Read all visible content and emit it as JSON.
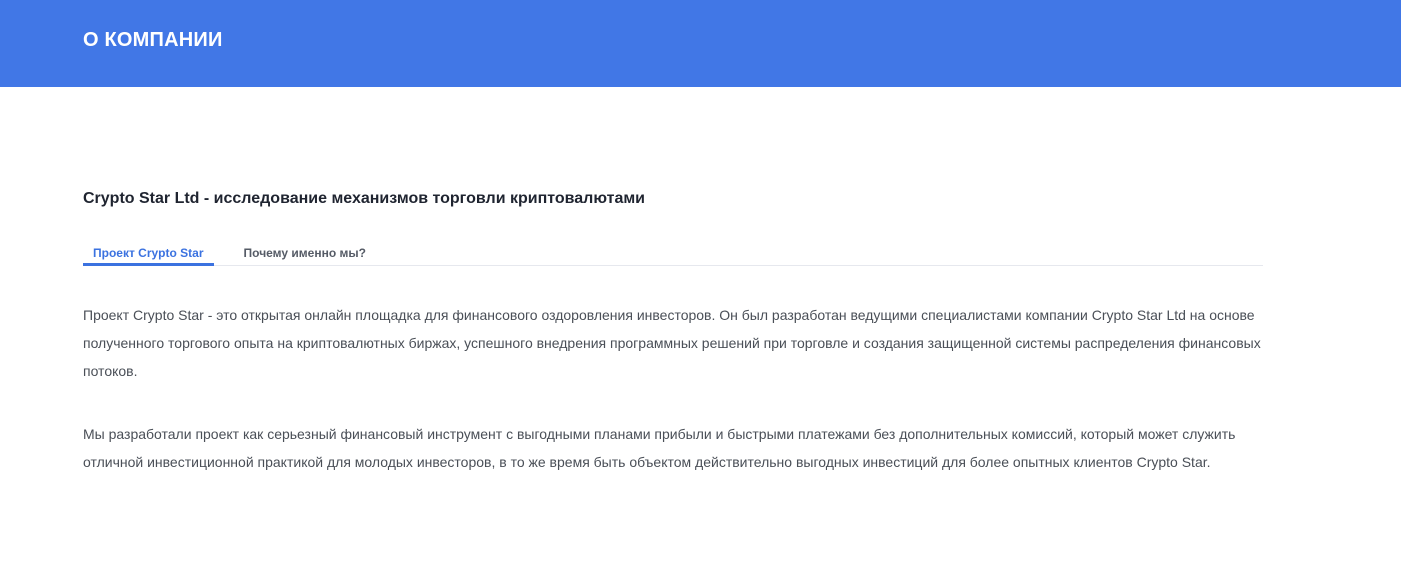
{
  "header": {
    "title": "О КОМПАНИИ"
  },
  "section": {
    "title": "Crypto Star Ltd - исследование механизмов торговли криптовалютами"
  },
  "tabs": [
    {
      "label": "Проект Crypto Star",
      "active": true
    },
    {
      "label": "Почему именно мы?",
      "active": false
    }
  ],
  "content": {
    "paragraphs": [
      "Проект Crypto Star - это открытая онлайн площадка для финансового оздоровления инвесторов. Он был разработан ведущими специалистами компании Crypto Star Ltd на основе полученного торгового опыта на криптовалютных биржах, успешного внедрения программных решений при торговле и создания защищенной системы распределения финансовых потоков.",
      "Мы разработали проект как серьезный финансовый инструмент с выгодными планами прибыли и быстрыми платежами без дополнительных комиссий, который может служить отличной инвестиционной практикой для молодых инвесторов, в то же время быть объектом действительно выгодных инвестиций для более опытных клиентов Crypto Star."
    ]
  },
  "colors": {
    "header_bg": "#4177e6",
    "accent": "#3b72e0",
    "text": "#4a4f57",
    "title": "#1f2430"
  }
}
